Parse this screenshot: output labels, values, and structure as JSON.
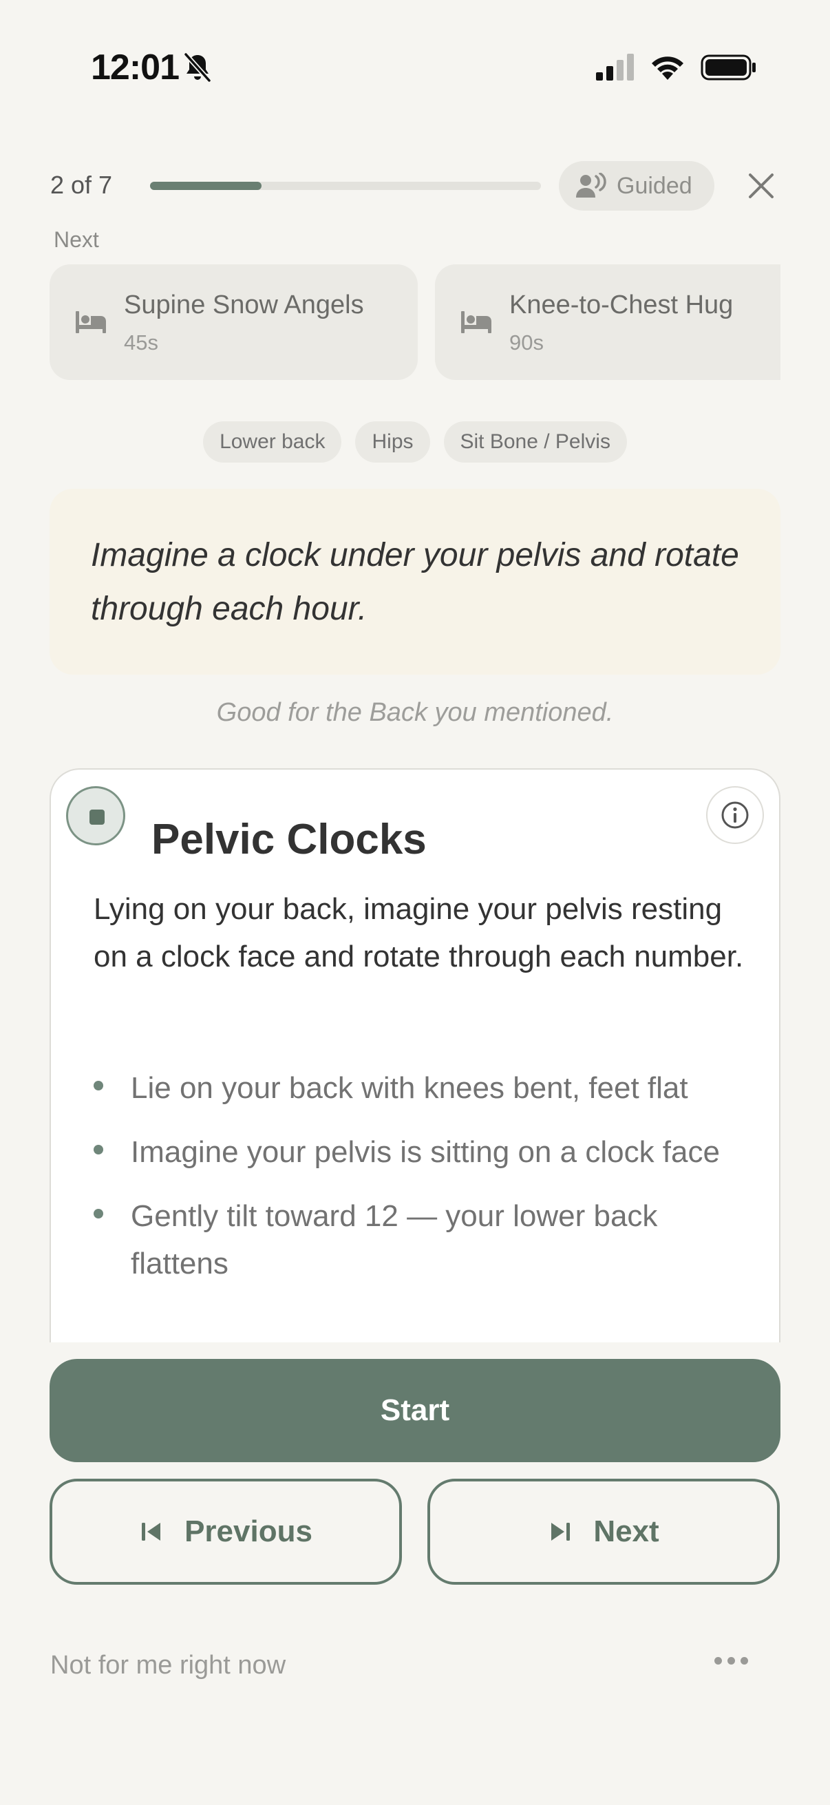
{
  "status_bar": {
    "time": "12:01",
    "icons": [
      "bell-off-icon",
      "cellular-signal-icon",
      "wifi-icon",
      "battery-icon"
    ]
  },
  "session": {
    "progress_label": "2 of 7",
    "progress_fraction": 0.2857,
    "guided_label": "Guided",
    "guided_icon": "speaking-person-icon",
    "close_icon": "close-icon"
  },
  "next_section": {
    "caption": "Next",
    "items": [
      {
        "title": "Supine Snow Angels",
        "duration": "45s",
        "icon": "bed-icon"
      },
      {
        "title": "Knee-to-Chest Hug",
        "duration": "90s",
        "icon": "bed-icon"
      }
    ]
  },
  "tags": [
    "Lower back",
    "Hips",
    "Sit Bone / Pelvis"
  ],
  "quote": "Imagine a clock under your pelvis and rotate through each hour.",
  "reason": "Good for the Back you mentioned.",
  "exercise": {
    "title": "Pelvic Clocks",
    "description": "Lying on your back, imagine your pelvis resting on a clock face and rotate through each number.",
    "steps": [
      "Lie on your back with knees bent, feet flat",
      "Imagine your pelvis is sitting on a clock face",
      "Gently tilt toward 12 — your lower back flattens"
    ],
    "stop_icon": "stop-icon",
    "info_icon": "info-icon"
  },
  "actions": {
    "start_label": "Start",
    "previous_label": "Previous",
    "next_label": "Next",
    "skip_label": "Not for me right now",
    "more_icon": "more-icon"
  },
  "colors": {
    "background": "#f6f5f1",
    "accent": "#647b6e",
    "quote_background": "#f7f3e8",
    "chip_background": "#eae9e4"
  }
}
